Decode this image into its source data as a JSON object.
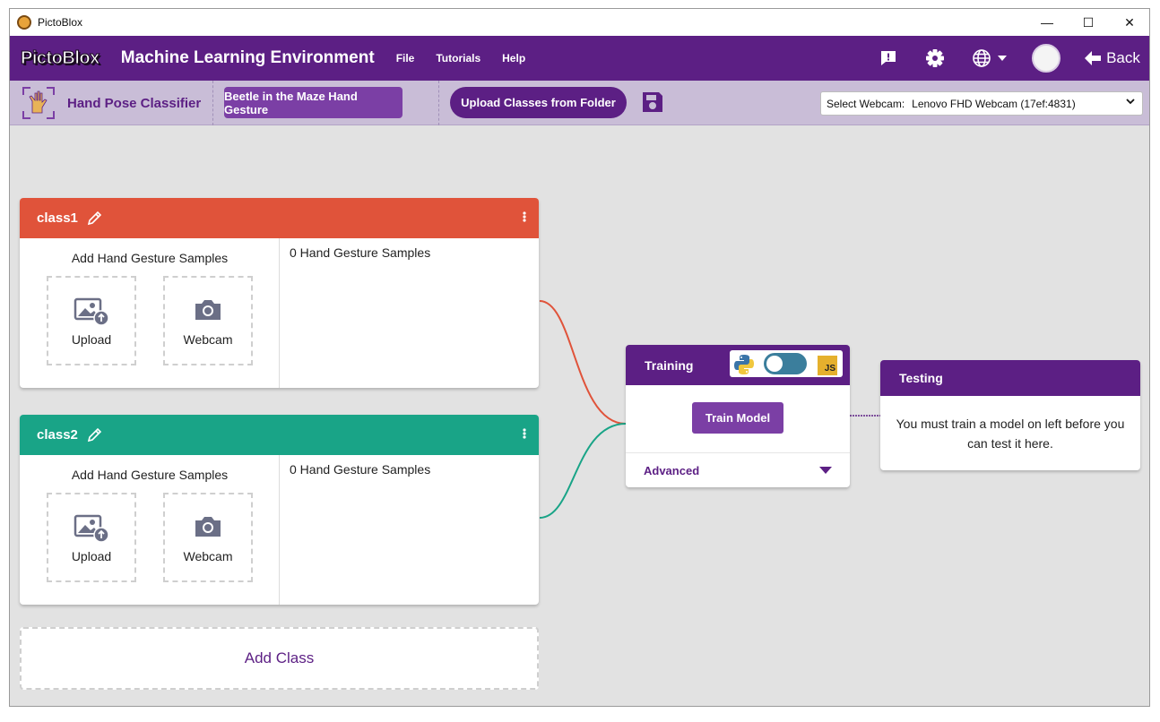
{
  "window": {
    "title": "PictoBlox",
    "minimize_glyph": "—",
    "maximize_glyph": "☐",
    "close_glyph": "✕"
  },
  "header": {
    "logo": "PictoBlox",
    "title": "Machine Learning Environment",
    "menu": [
      "File",
      "Tutorials",
      "Help"
    ],
    "back_label": "Back",
    "icons": [
      "feedback-icon",
      "gear-icon",
      "globe-icon",
      "avatar",
      "back-arrow-icon"
    ]
  },
  "toolbar": {
    "project_type": "Hand Pose Classifier",
    "example_button": "Beetle in the Maze Hand Gesture",
    "upload_button": "Upload Classes from Folder",
    "webcam_label": "Select Webcam:",
    "webcam_value": "Lenovo FHD Webcam (17ef:4831)"
  },
  "classes": [
    {
      "name": "class1",
      "color": "#e0533a",
      "add_title": "Add Hand Gesture Samples",
      "upload_label": "Upload",
      "webcam_label": "Webcam",
      "samples_text": "0 Hand Gesture Samples"
    },
    {
      "name": "class2",
      "color": "#19a487",
      "add_title": "Add Hand Gesture Samples",
      "upload_label": "Upload",
      "webcam_label": "Webcam",
      "samples_text": "0 Hand Gesture Samples"
    }
  ],
  "add_class_label": "Add Class",
  "training": {
    "title": "Training",
    "js_label": "JS",
    "train_button": "Train Model",
    "advanced_label": "Advanced"
  },
  "testing": {
    "title": "Testing",
    "message": "You must train a model on left before you can test it here."
  },
  "colors": {
    "brand_purple": "#5c1f84",
    "toolbar": "#c9bdd7",
    "canvas": "#e2e2e2"
  }
}
